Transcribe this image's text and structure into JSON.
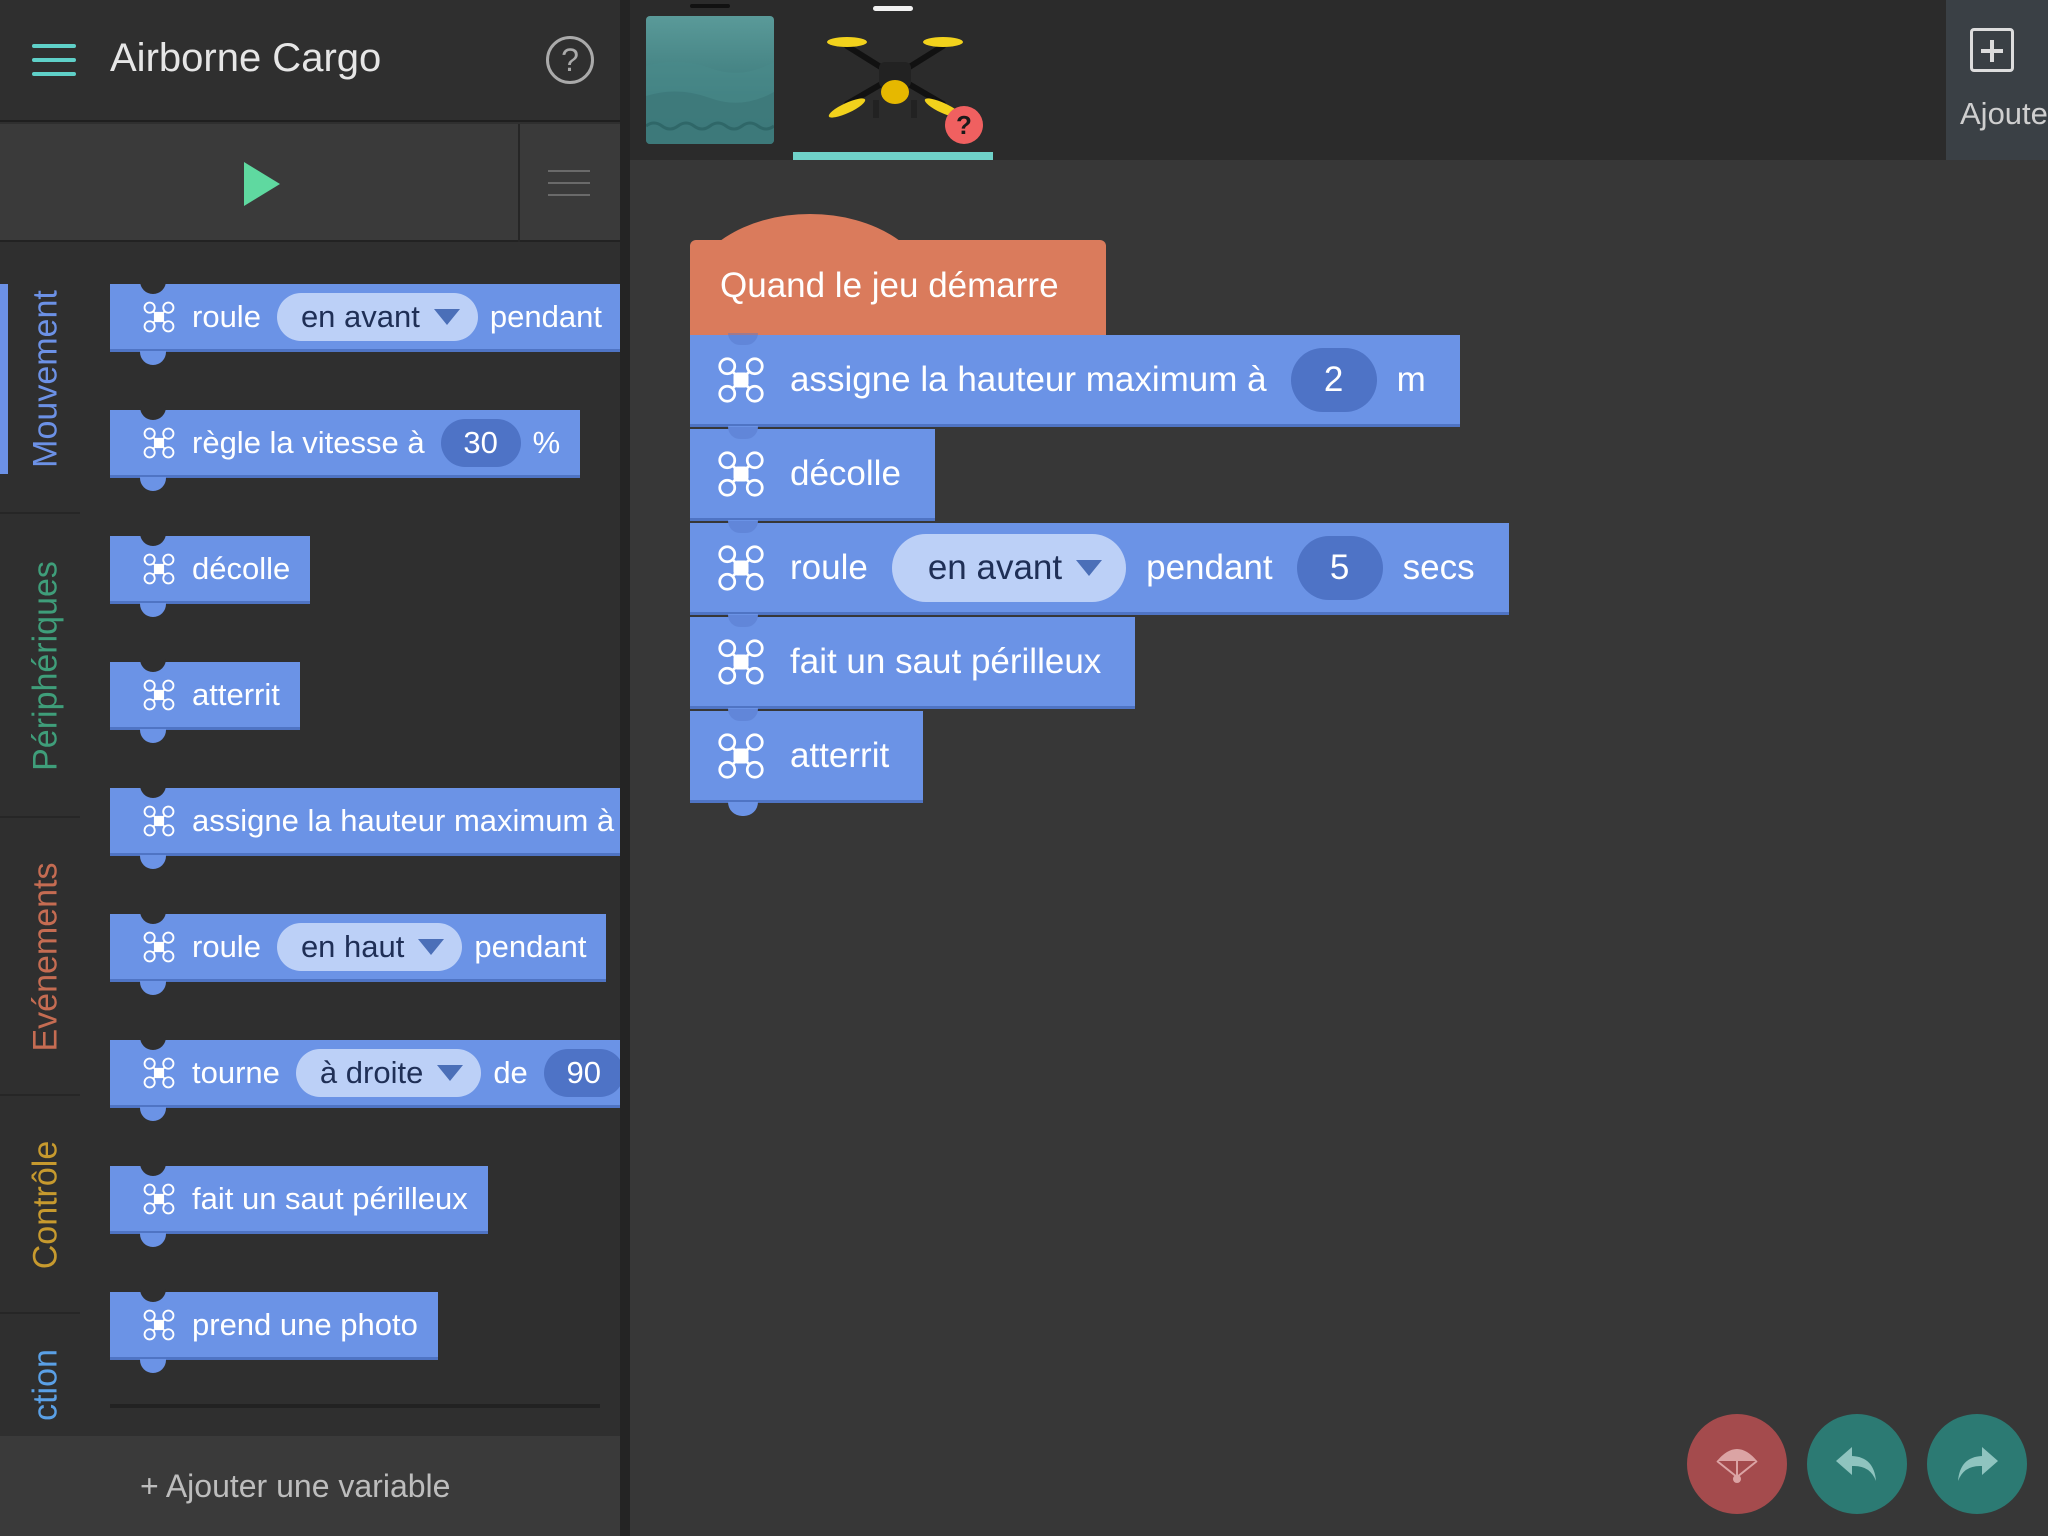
{
  "header": {
    "title": "Airborne Cargo",
    "help_symbol": "?"
  },
  "tabs": [
    {
      "label": "Mouvement",
      "color": "#6c91e6"
    },
    {
      "label": "Périphériques",
      "color": "#3f9e7a"
    },
    {
      "label": "Evénements",
      "color": "#c56c52"
    },
    {
      "label": "Contrôle",
      "color": "#c79a2e"
    },
    {
      "label": "ction",
      "color": "#5aa0e6"
    }
  ],
  "palette": [
    {
      "text": "roule",
      "pill": "en avant",
      "after": "pendant"
    },
    {
      "text": "règle la vitesse à",
      "num": "30",
      "after": "%"
    },
    {
      "text": "décolle"
    },
    {
      "text": "atterrit"
    },
    {
      "text": "assigne la hauteur maximum à"
    },
    {
      "text": "roule",
      "pill": "en haut",
      "after": "pendant"
    },
    {
      "text": "tourne",
      "pill": "à droite",
      "after": "de",
      "num2": "90"
    },
    {
      "text": "fait un saut périlleux"
    },
    {
      "text": "prend une photo"
    }
  ],
  "add_variable": "+ Ajouter une variable",
  "top_strip": {
    "add_label": "Ajouter",
    "warning": "?"
  },
  "program": {
    "hat": "Quand le jeu démarre",
    "blocks": [
      {
        "text": "assigne la hauteur maximum à",
        "num": "2",
        "after": "m"
      },
      {
        "text": "décolle"
      },
      {
        "text": "roule",
        "pill": "en avant",
        "after": "pendant",
        "num2": "5",
        "after2": "secs"
      },
      {
        "text": "fait un saut périlleux"
      },
      {
        "text": "atterrit"
      }
    ]
  },
  "colors": {
    "motion_block": "#6b93e6",
    "event_block": "#da7b5c",
    "accent": "#6fd2c9",
    "play": "#5fd9a0"
  },
  "icons": {
    "menu": "hamburger-icon",
    "help": "help-icon",
    "play": "play-icon",
    "list": "list-icon",
    "drone": "drone-icon",
    "add": "plus-icon",
    "parachute": "parachute-icon",
    "undo": "undo-icon",
    "redo": "redo-icon"
  }
}
